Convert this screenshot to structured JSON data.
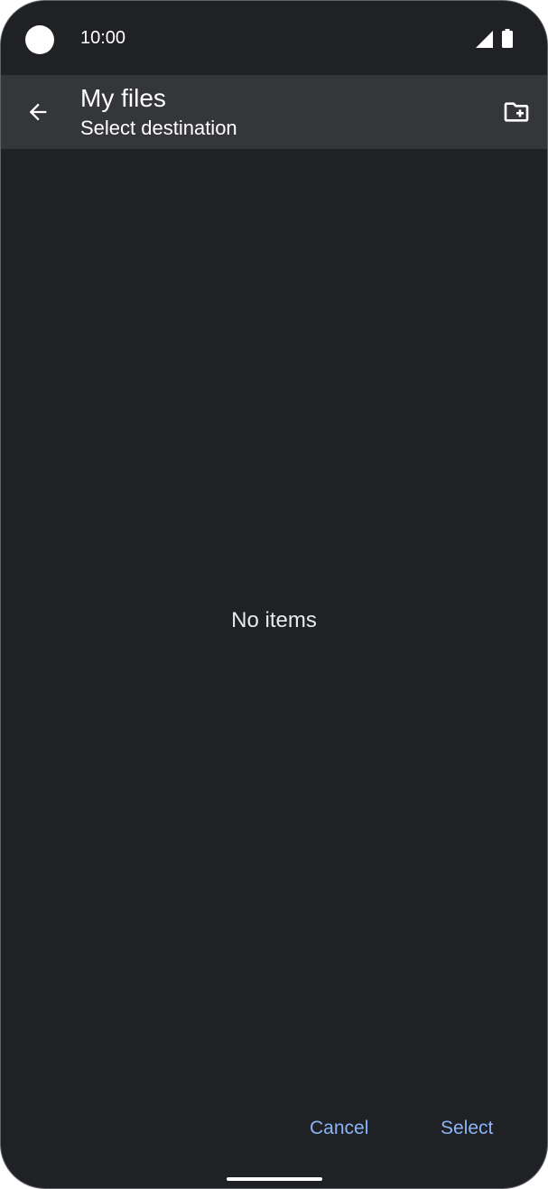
{
  "status_bar": {
    "time": "10:00",
    "icons": [
      "signal-icon",
      "battery-icon"
    ]
  },
  "app_bar": {
    "back_icon": "arrow-back-icon",
    "title": "My files",
    "subtitle": "Select destination",
    "action_icon": "create-new-folder-icon"
  },
  "content": {
    "empty_message": "No items"
  },
  "footer": {
    "cancel_label": "Cancel",
    "select_label": "Select"
  },
  "colors": {
    "background": "#202124",
    "app_bar": "#35363a",
    "accent": "#8ab4f8",
    "text": "#ffffff"
  }
}
